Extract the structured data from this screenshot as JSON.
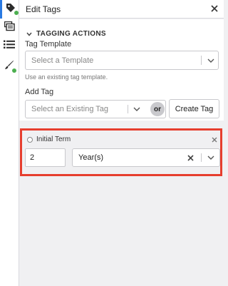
{
  "rail": {
    "items": [
      {
        "icon": "tag-icon",
        "active": true,
        "badge": true
      },
      {
        "icon": "layers-icon",
        "active": false,
        "badge": false
      },
      {
        "icon": "list-icon",
        "active": false,
        "badge": false
      },
      {
        "icon": "brush-icon",
        "active": false,
        "badge": true
      }
    ]
  },
  "header": {
    "title": "Edit Tags",
    "close_icon": "close-icon"
  },
  "section": {
    "title": "TAGGING ACTIONS",
    "template_label": "Tag Template",
    "template_placeholder": "Select a Template",
    "template_helper": "Use an existing tag template.",
    "add_tag_label": "Add Tag",
    "tag_placeholder": "Select an Existing Tag",
    "or_label": "or",
    "create_tag_label": "Create Tag"
  },
  "tag_item": {
    "label": "Initial Term",
    "value": "2",
    "unit": "Year(s)"
  },
  "colors": {
    "accent": "#2a7ae2",
    "highlight": "#e63e2e",
    "badge": "#4caf50"
  }
}
